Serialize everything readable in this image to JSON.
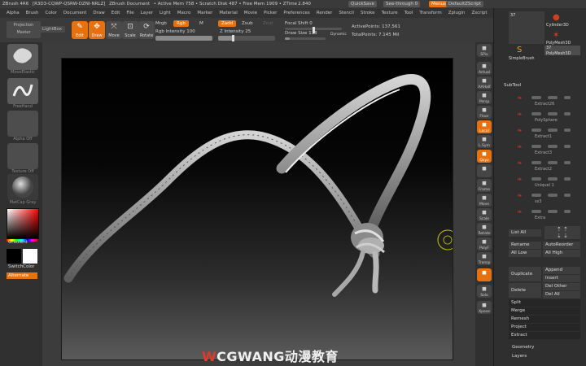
{
  "title_bar": {
    "app": "ZBrush 4R6",
    "id": "[R3D3-CQWP-QSRW-DZNI-NRLZ]",
    "doc": "ZBrush Document",
    "stats": "• Active Mem 758 • Scratch Disk 487 • Free Mem 1909 • ZTime 2.840",
    "quicksave": "QuickSave",
    "seethrough": "See-through  0",
    "menus": "Menus",
    "script": "DefaultZScript"
  },
  "menubar": [
    "Alpha",
    "Brush",
    "Color",
    "Document",
    "Draw",
    "Edit",
    "File",
    "Layer",
    "Light",
    "Macro",
    "Marker",
    "Material",
    "Movie",
    "Picker",
    "Preferences",
    "Render",
    "Stencil",
    "Stroke",
    "Texture",
    "Tool",
    "Transform",
    "Zplugin",
    "Zscript"
  ],
  "toolbar": {
    "projection_master": "Projection Master",
    "lightbox": "LightBox",
    "edit": "Edit",
    "draw": "Draw",
    "move": "Move",
    "scale": "Scale",
    "rotate": "Rotate",
    "mrgb": "Mrgb",
    "rgb": "Rgb",
    "m": "M",
    "rgb_intensity": "Rgb Intensity 100",
    "zadd": "Zadd",
    "zsub": "Zsub",
    "zcut": "Zcut",
    "z_intensity": "Z Intensity 25",
    "focal_shift": "Focal Shift 0",
    "draw_size": "Draw Size 118",
    "dynamic": "Dynamic",
    "active_points": "ActivePoints: 137,561",
    "total_points": "TotalPoints: 7.145 Mil"
  },
  "left_shelf": {
    "brush_label": "MoveElastic",
    "stroke_label": "FreeHand",
    "alpha_label": "Alpha Off",
    "texture_label": "Texture Off",
    "material_label": "MatCap Gray",
    "gradient": "Gradient",
    "switch_color": "SwitchColor",
    "alternate": "Alternate",
    "brush_icon": "brush-blob-icon",
    "stroke_icon": "stroke-z-icon"
  },
  "right_shelf": [
    {
      "label": "SPix",
      "icon": "sphere-icon"
    },
    {
      "label": "Actual",
      "icon": "actual-icon"
    },
    {
      "label": "AAHalf",
      "icon": "aahalf-icon"
    },
    {
      "label": "Persp",
      "icon": "persp-icon"
    },
    {
      "label": "Floor",
      "icon": "floor-icon"
    },
    {
      "label": "Local",
      "icon": "local-icon",
      "active": true
    },
    {
      "label": "L.Sym",
      "icon": "lsym-icon"
    },
    {
      "label": "Qxyz",
      "icon": "xyz-icon",
      "active": true
    },
    {
      "label": "",
      "icon": "rotate-axis-icon"
    },
    {
      "label": "Frame",
      "icon": "frame-icon"
    },
    {
      "label": "Move",
      "icon": "move-icon"
    },
    {
      "label": "Scale",
      "icon": "scale-icon"
    },
    {
      "label": "Rotate",
      "icon": "rotate-icon"
    },
    {
      "label": "PolyF",
      "icon": "polyf-icon"
    },
    {
      "label": "Transp",
      "icon": "transp-icon"
    },
    {
      "label": "",
      "icon": "ghost-icon",
      "active": true
    },
    {
      "label": "Solo",
      "icon": "solo-icon"
    },
    {
      "label": "Xpose",
      "icon": "xpose-icon"
    }
  ],
  "palette": {
    "tool_thumbs": [
      {
        "label": "Cylinder3D"
      },
      {
        "label": "PolyMesh3D"
      },
      {
        "label": "SimpleBrush"
      }
    ],
    "count_a": "37",
    "count_b": "37",
    "polymesh_label": "PolyMesh3D",
    "subtool_title": "SubTool",
    "subtools": [
      "Extract26",
      "PolySphere",
      "Extract1",
      "Extract3",
      "Extract2",
      "Uniquel 1",
      "ss3",
      "Extra"
    ],
    "list_all": "List All",
    "rename": "Rename",
    "auto_reorder": "AutoReorder",
    "all_low": "All Low",
    "all_high": "All High",
    "duplicate": "Duplicate",
    "append": "Append",
    "insert": "Insert",
    "delete": "Delete",
    "del_other": "Del Other",
    "del_all": "Del All",
    "split": "Split",
    "merge": "Merge",
    "remesh": "Remesh",
    "project": "Project",
    "extract": "Extract",
    "geometry": "Geometry",
    "layers": "Layers"
  },
  "watermark": {
    "brand": "CGWANG",
    "cn": "动漫教育"
  },
  "colors": {
    "accent": "#e8710f",
    "bg": "#2b2b2b",
    "panel": "#303030"
  }
}
